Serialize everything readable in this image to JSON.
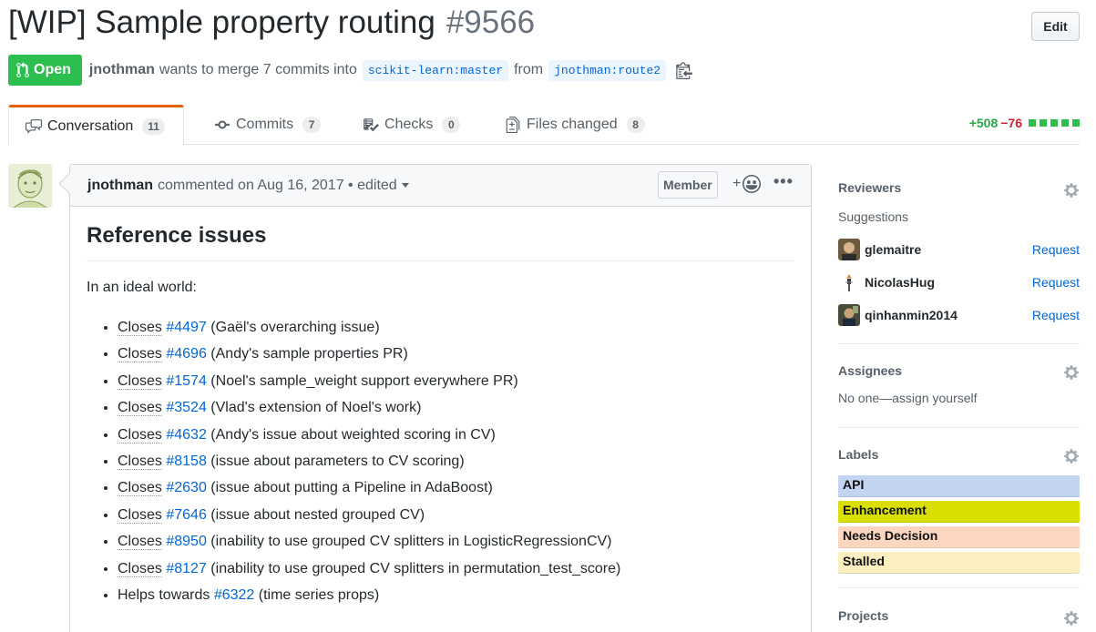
{
  "pr": {
    "title": "[WIP] Sample property routing",
    "number": "#9566",
    "edit_label": "Edit",
    "state": "Open",
    "author": "jnothman",
    "merge_text": "wants to merge 7 commits into",
    "base_branch": "scikit-learn:master",
    "from_text": "from",
    "head_branch": "jnothman:route2"
  },
  "tabs": [
    {
      "label": "Conversation",
      "count": "11",
      "icon": "comment-discussion-icon"
    },
    {
      "label": "Commits",
      "count": "7",
      "icon": "git-commit-icon"
    },
    {
      "label": "Checks",
      "count": "0",
      "icon": "checklist-icon"
    },
    {
      "label": "Files changed",
      "count": "8",
      "icon": "diff-icon"
    }
  ],
  "diffstat": {
    "additions": "+508",
    "deletions": "−76",
    "colors": [
      "#2cbe4e",
      "#2cbe4e",
      "#2cbe4e",
      "#2cbe4e",
      "#2cbe4e"
    ]
  },
  "comment": {
    "author": "jnothman",
    "meta": "commented on Aug 16, 2017 • edited",
    "role": "Member",
    "reaction_plus": "+",
    "heading": "Reference issues",
    "intro": "In an ideal world:",
    "items": [
      {
        "prefix": "Closes",
        "ref": "#4497",
        "desc": " (Gaël's overarching issue)"
      },
      {
        "prefix": "Closes",
        "ref": "#4696",
        "desc": " (Andy's sample properties PR)"
      },
      {
        "prefix": "Closes",
        "ref": "#1574",
        "desc": " (Noel's sample_weight support everywhere PR)"
      },
      {
        "prefix": "Closes",
        "ref": "#3524",
        "desc": " (Vlad's extension of Noel's work)"
      },
      {
        "prefix": "Closes",
        "ref": "#4632",
        "desc": " (Andy's issue about weighted scoring in CV)"
      },
      {
        "prefix": "Closes",
        "ref": "#8158",
        "desc": " (issue about parameters to CV scoring)"
      },
      {
        "prefix": "Closes",
        "ref": "#2630",
        "desc": " (issue about putting a Pipeline in AdaBoost)"
      },
      {
        "prefix": "Closes",
        "ref": "#7646",
        "desc": " (issue about nested grouped CV)"
      },
      {
        "prefix": "Closes",
        "ref": "#8950",
        "desc": " (inability to use grouped CV splitters in LogisticRegressionCV)"
      },
      {
        "prefix": "Closes",
        "ref": "#8127",
        "desc": " (inability to use grouped CV splitters in permutation_test_score)"
      },
      {
        "prefix": "Helps towards",
        "ref": "#6322",
        "desc": " (time series props)"
      }
    ]
  },
  "sidebar": {
    "reviewers": {
      "heading": "Reviewers",
      "sub": "Suggestions",
      "request_label": "Request",
      "people": [
        "glemaitre",
        "NicolasHug",
        "qinhanmin2014"
      ]
    },
    "assignees": {
      "heading": "Assignees",
      "text": "No one—assign yourself"
    },
    "labels": {
      "heading": "Labels",
      "items": [
        {
          "name": "API",
          "color": "#c2d4f0"
        },
        {
          "name": "Enhancement",
          "color": "#d9e000"
        },
        {
          "name": "Needs Decision",
          "color": "#fcd6bf"
        },
        {
          "name": "Stalled",
          "color": "#fbefc0"
        }
      ]
    },
    "projects": {
      "heading": "Projects"
    }
  }
}
